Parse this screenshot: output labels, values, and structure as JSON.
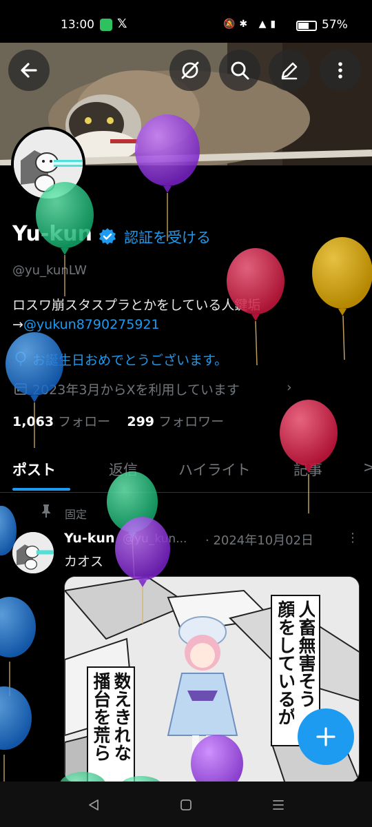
{
  "status_bar": {
    "time": "13:00",
    "notification_icons": [
      "app-notification-icon",
      "x-logo-icon"
    ],
    "system_icons": [
      "mute-icon",
      "bluetooth-icon",
      "volte-icon",
      "signal-4g-icon",
      "battery-icon"
    ],
    "battery_percent": "57%"
  },
  "header": {
    "buttons": [
      "back-arrow-icon",
      "hide-icon",
      "search-icon",
      "edit-icon",
      "more-vertical-icon"
    ]
  },
  "profile": {
    "display_name": "Yu-kun",
    "verify_link": "認証を受ける",
    "handle": "@yu_kunLW",
    "bio_line1": "ロスワ崩スタスプラとかをしている人鍵垢",
    "bio_arrow": "→",
    "bio_link": "@yukun8790275921",
    "birthday_text": "お誕生日おめでとうございます。",
    "joined_text": "2023年3月からXを利用しています",
    "following_count": "1,063",
    "following_label": "フォロー",
    "followers_count": "299",
    "followers_label": "フォロワー"
  },
  "tabs": [
    {
      "label": "ポスト",
      "active": true
    },
    {
      "label": "返信",
      "active": false
    },
    {
      "label": "ハイライト",
      "active": false
    },
    {
      "label": "記事",
      "active": false
    },
    {
      "label": ">",
      "active": false
    }
  ],
  "pinned_post": {
    "pinned_label": "固定",
    "author_name": "Yu-kun",
    "author_handle": "@yu_kun...",
    "date": "· 2024年10月02日",
    "text": "カオス",
    "image_caption_right": [
      "人畜無害そう",
      "顔をしているが"
    ],
    "image_caption_left": [
      "数えきれな",
      "播台を荒ら"
    ]
  },
  "colors": {
    "accent": "#1d9bf0",
    "background": "#000000",
    "muted_text": "#71767b",
    "primary_text": "#e7e9ea"
  },
  "nav_bar": {
    "buttons": [
      "back-triangle-icon",
      "home-square-icon",
      "recents-menu-icon"
    ]
  }
}
